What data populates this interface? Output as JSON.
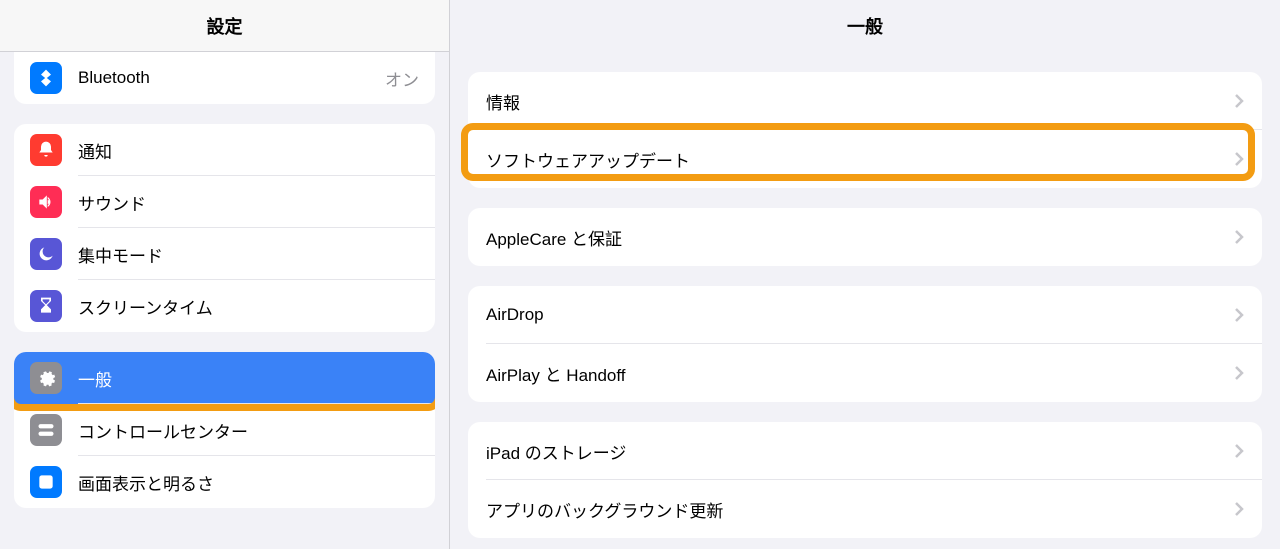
{
  "sidebar": {
    "title": "設定",
    "sections": {
      "0": {
        "bluetooth": {
          "label": "Bluetooth",
          "status": "オン"
        }
      },
      "1": {
        "notifications": {
          "label": "通知"
        },
        "sounds": {
          "label": "サウンド"
        },
        "focus": {
          "label": "集中モード"
        },
        "screentime": {
          "label": "スクリーンタイム"
        }
      },
      "2": {
        "general": {
          "label": "一般"
        },
        "controlcenter": {
          "label": "コントロールセンター"
        },
        "display": {
          "label": "画面表示と明るさ"
        }
      }
    }
  },
  "detail": {
    "title": "一般",
    "sections": {
      "0": {
        "about": {
          "label": "情報"
        },
        "softwareupdate": {
          "label": "ソフトウェアアップデート"
        }
      },
      "1": {
        "applecare": {
          "label": "AppleCare と保証"
        }
      },
      "2": {
        "airdrop": {
          "label": "AirDrop"
        },
        "airplay": {
          "label": "AirPlay と Handoff"
        }
      },
      "3": {
        "storage": {
          "label": "iPad のストレージ"
        },
        "backgroundrefresh": {
          "label": "アプリのバックグラウンド更新"
        }
      }
    }
  },
  "highlight": {
    "sidebar_item": "general",
    "detail_item": "softwareupdate"
  }
}
